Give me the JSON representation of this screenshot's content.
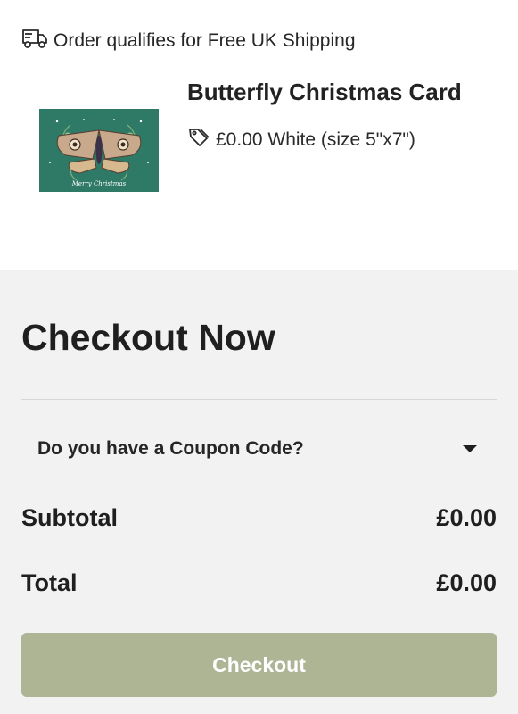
{
  "shipping": {
    "message": "Order qualifies for Free UK Shipping",
    "icon": "truck-icon"
  },
  "product": {
    "name": "Butterfly Christmas Card",
    "price_variant": "£0.00 White (size 5\"x7\")",
    "thumbnail_caption": "Merry Christmas",
    "tag_icon": "price-tag-icon",
    "thumbnail_bg": "#2e7a66"
  },
  "checkout": {
    "title": "Checkout Now",
    "coupon_label": "Do you have a Coupon Code?",
    "subtotal_label": "Subtotal",
    "subtotal_value": "£0.00",
    "total_label": "Total",
    "total_value": "£0.00",
    "button_label": "Checkout",
    "button_color": "#adb595",
    "panel_bg": "#f2f2f2"
  }
}
